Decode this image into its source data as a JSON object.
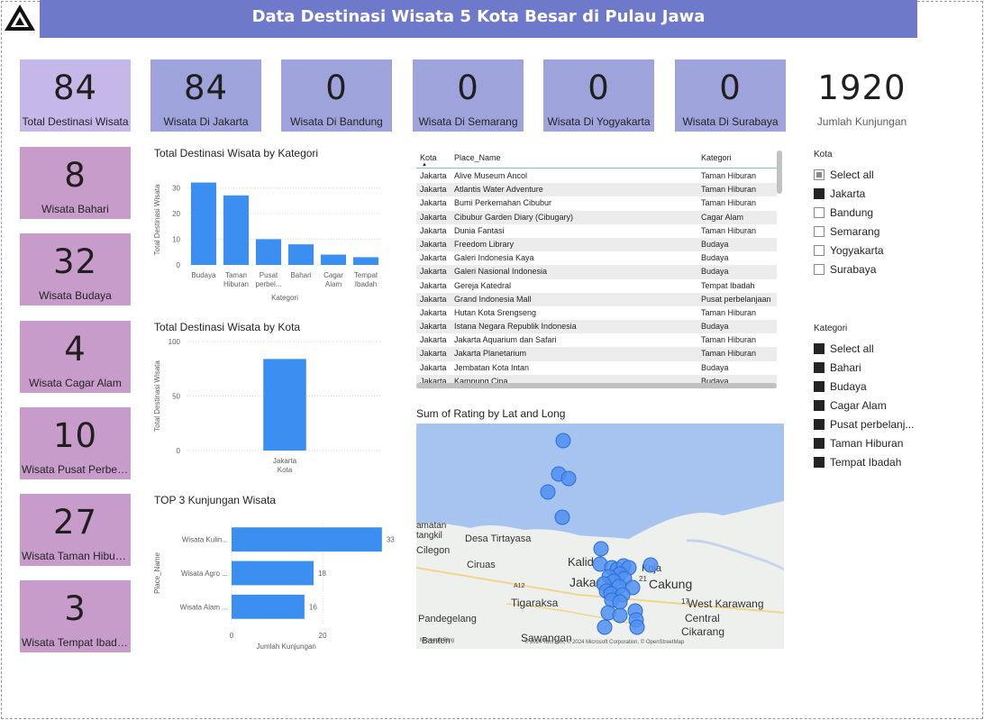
{
  "header": {
    "title": "Data Destinasi Wisata 5 Kota Besar di Pulau Jawa"
  },
  "colors": {
    "banner": "#6f79c9",
    "bar": "#3b8ff0",
    "card_top_light": "#c5b8e8",
    "card_top": "#9fa3dc",
    "card_side": "#c79ccb",
    "map_water": "#a7c3f0",
    "map_land": "#eef0ee",
    "marker": "#4f8ff2"
  },
  "top_cards": [
    {
      "value": "84",
      "label": "Total Destinasi Wisata"
    },
    {
      "value": "84",
      "label": "Wisata Di Jakarta"
    },
    {
      "value": "0",
      "label": "Wisata Di Bandung"
    },
    {
      "value": "0",
      "label": "Wisata Di Semarang"
    },
    {
      "value": "0",
      "label": "Wisata Di Yogyakarta"
    },
    {
      "value": "0",
      "label": "Wisata Di Surabaya"
    },
    {
      "value": "1920",
      "label": "Jumlah Kunjungan"
    }
  ],
  "side_cards": [
    {
      "value": "8",
      "label": "Wisata Bahari"
    },
    {
      "value": "32",
      "label": "Wisata Budaya"
    },
    {
      "value": "4",
      "label": "Wisata Cagar Alam"
    },
    {
      "value": "10",
      "label": "Wisata Pusat Perbela..."
    },
    {
      "value": "27",
      "label": "Wisata Taman Hiburan"
    },
    {
      "value": "3",
      "label": "Wisata Tempat Ibadah"
    }
  ],
  "charts": {
    "kategori_title": "Total Destinasi Wisata by Kategori",
    "kota_title": "Total Destinasi Wisata by Kota",
    "top3_title": "TOP 3 Kunjungan Wisata",
    "map_title": "Sum of Rating by Lat and Long"
  },
  "chart_data": [
    {
      "type": "bar",
      "title": "Total Destinasi Wisata by Kategori",
      "categories": [
        "Budaya",
        "Taman Hiburan",
        "Pusat perbel...",
        "Bahari",
        "Cagar Alam",
        "Tempat Ibadah"
      ],
      "values": [
        32,
        27,
        10,
        8,
        4,
        3
      ],
      "xlabel": "Kategori",
      "ylabel": "Total Destinasi Wisata",
      "ylim": [
        0,
        35
      ],
      "yticks": [
        0,
        10,
        20,
        30
      ],
      "grid": true
    },
    {
      "type": "bar",
      "title": "Total Destinasi Wisata by Kota",
      "categories": [
        "Jakarta"
      ],
      "values": [
        84
      ],
      "xlabel": "Kota",
      "ylabel": "Total Destinasi Wisata",
      "ylim": [
        0,
        100
      ],
      "yticks": [
        0,
        50,
        100
      ],
      "grid": true
    },
    {
      "type": "bar",
      "orientation": "horizontal",
      "title": "TOP 3 Kunjungan Wisata",
      "categories": [
        "Wisata Kulin...",
        "Wisata Agro ...",
        "Wisata Alam ..."
      ],
      "values": [
        33,
        18,
        16
      ],
      "xlabel": "Jumlah Kunjungan",
      "ylabel": "Place_Name",
      "xlim": [
        0,
        36
      ],
      "xticks": [
        0,
        20
      ],
      "grid": true
    }
  ],
  "table": {
    "columns": [
      "Kota",
      "Place_Name",
      "Kategori"
    ],
    "rows": [
      [
        "Jakarta",
        "Alive Museum Ancol",
        "Taman Hiburan"
      ],
      [
        "Jakarta",
        "Atlantis Water Adventure",
        "Taman Hiburan"
      ],
      [
        "Jakarta",
        "Bumi Perkemahan Cibubur",
        "Taman Hiburan"
      ],
      [
        "Jakarta",
        "Cibubur Garden Diary (Cibugary)",
        "Cagar Alam"
      ],
      [
        "Jakarta",
        "Dunia Fantasi",
        "Taman Hiburan"
      ],
      [
        "Jakarta",
        "Freedom Library",
        "Budaya"
      ],
      [
        "Jakarta",
        "Galeri Indonesia Kaya",
        "Budaya"
      ],
      [
        "Jakarta",
        "Galeri Nasional Indonesia",
        "Budaya"
      ],
      [
        "Jakarta",
        "Gereja Katedral",
        "Tempat Ibadah"
      ],
      [
        "Jakarta",
        "Grand Indonesia Mall",
        "Pusat perbelanjaan"
      ],
      [
        "Jakarta",
        "Hutan Kota Srengseng",
        "Taman Hiburan"
      ],
      [
        "Jakarta",
        "Istana Negara Republik Indonesia",
        "Budaya"
      ],
      [
        "Jakarta",
        "Jakarta Aquarium dan Safari",
        "Taman Hiburan"
      ],
      [
        "Jakarta",
        "Jakarta Planetarium",
        "Taman Hiburan"
      ],
      [
        "Jakarta",
        "Jembatan Kota Intan",
        "Budaya"
      ],
      [
        "Jakarta",
        "Kampung Cina",
        "Budaya"
      ]
    ]
  },
  "map": {
    "place_labels": [
      "Desa Tirtayasa",
      "Ciruas",
      "Kalid",
      "Jakar",
      "Cakung",
      "Koja",
      "Tigaraksa",
      "West Karawang",
      "Pandegelang",
      "Central",
      "Cikarang",
      "Sawangan",
      "Banten",
      "amatan",
      "tangkil",
      "Cilegon",
      "21",
      "17",
      "A12"
    ],
    "attribution": "© 2024 TomTom, © 2024 Microsoft Corporation, © OpenStreetMap",
    "bing": "Microsoft Bing"
  },
  "slicer_kota": {
    "title": "Kota",
    "items": [
      {
        "label": "Select all",
        "state": "partial"
      },
      {
        "label": "Jakarta",
        "state": "on"
      },
      {
        "label": "Bandung",
        "state": "off"
      },
      {
        "label": "Semarang",
        "state": "off"
      },
      {
        "label": "Yogyakarta",
        "state": "off"
      },
      {
        "label": "Surabaya",
        "state": "off"
      }
    ]
  },
  "slicer_kategori": {
    "title": "Kategori",
    "items": [
      {
        "label": "Select all",
        "state": "on"
      },
      {
        "label": "Bahari",
        "state": "on"
      },
      {
        "label": "Budaya",
        "state": "on"
      },
      {
        "label": "Cagar Alam",
        "state": "on"
      },
      {
        "label": "Pusat perbelanj...",
        "state": "on"
      },
      {
        "label": "Taman Hiburan",
        "state": "on"
      },
      {
        "label": "Tempat Ibadah",
        "state": "on"
      }
    ]
  }
}
